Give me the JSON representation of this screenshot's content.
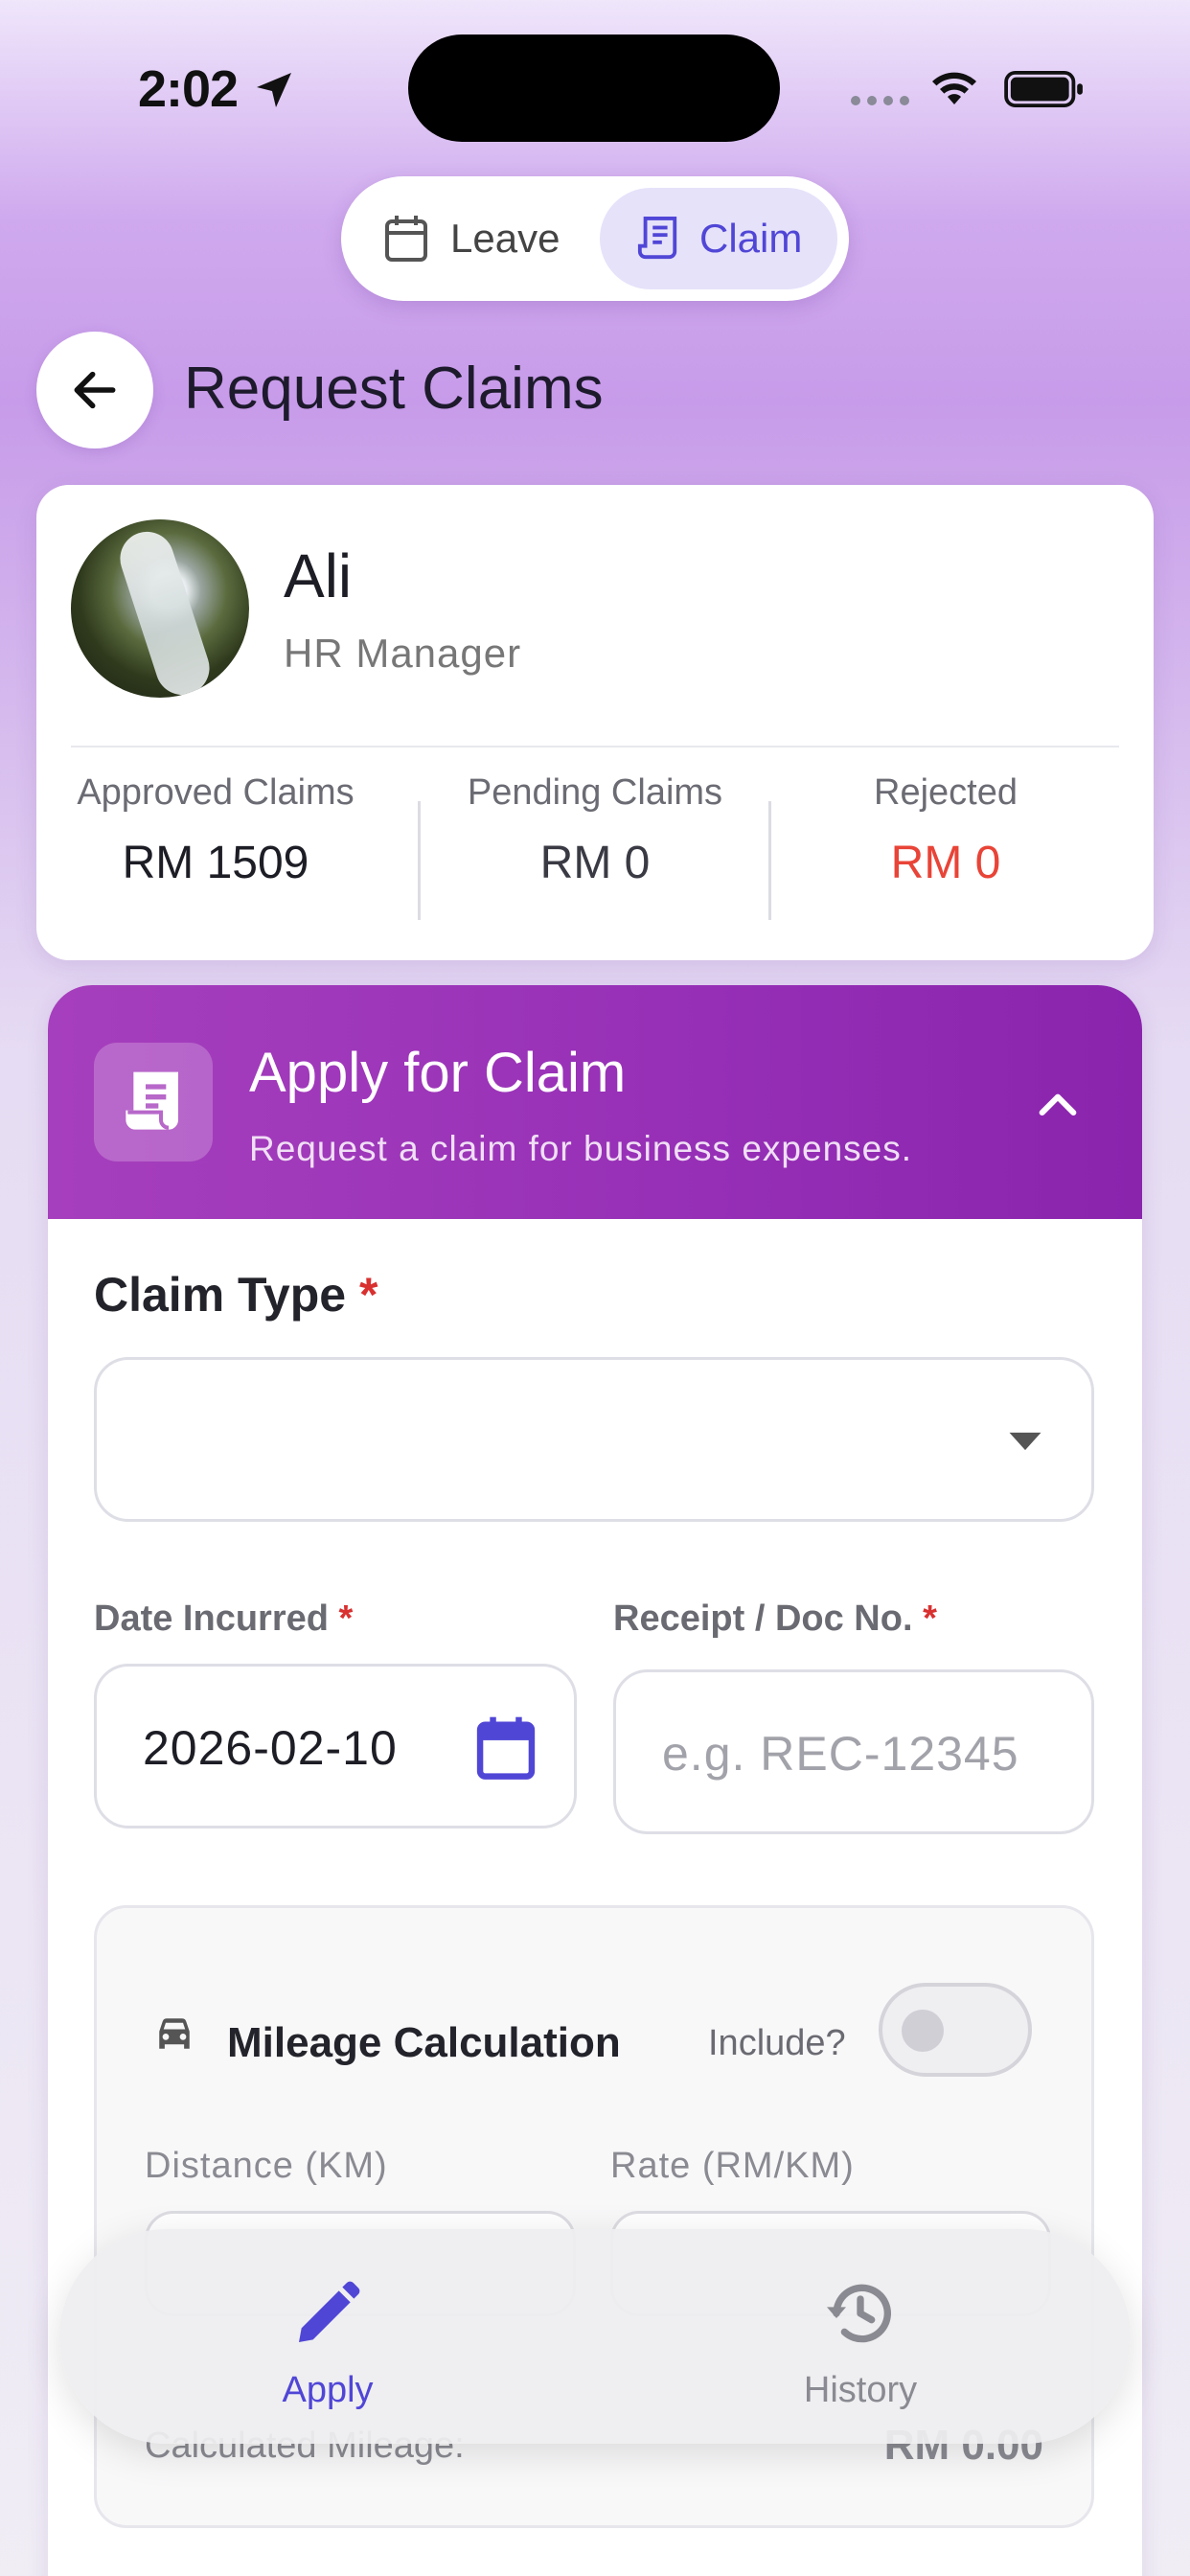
{
  "status_bar": {
    "time": "2:02"
  },
  "segment": {
    "leave_label": "Leave",
    "claim_label": "Claim",
    "active": "Claim"
  },
  "header": {
    "title": "Request Claims"
  },
  "profile": {
    "name": "Ali",
    "role": "HR Manager",
    "stats": [
      {
        "label": "Approved Claims",
        "value": "RM 1509",
        "color": "#1d1d26"
      },
      {
        "label": "Pending Claims",
        "value": "RM 0",
        "color": "#3a3a44"
      },
      {
        "label": "Rejected",
        "value": "RM 0",
        "color": "#e84437"
      }
    ]
  },
  "form": {
    "title": "Apply for Claim",
    "subtitle": "Request a claim for business expenses.",
    "claim_type_label": "Claim Type",
    "required_mark": "*",
    "claim_type_value": "",
    "date_label": "Date Incurred",
    "date_value": "2026-02-10",
    "receipt_label": "Receipt / Doc No.",
    "receipt_placeholder": "e.g. REC-12345",
    "mileage": {
      "title": "Mileage Calculation",
      "include_label": "Include?",
      "include_on": false,
      "distance_label": "Distance (KM)",
      "rate_label": "Rate (RM/KM)",
      "calculated_label": "Calculated Mileage:",
      "calculated_value": "RM 0.00"
    }
  },
  "bottom_nav": {
    "items": [
      {
        "label": "Apply",
        "active": true
      },
      {
        "label": "History",
        "active": false
      }
    ]
  },
  "colors": {
    "accent": "#5046d6",
    "header_gradient_start": "#a63fbd",
    "header_gradient_end": "#8a24ad",
    "danger": "#e84437"
  }
}
